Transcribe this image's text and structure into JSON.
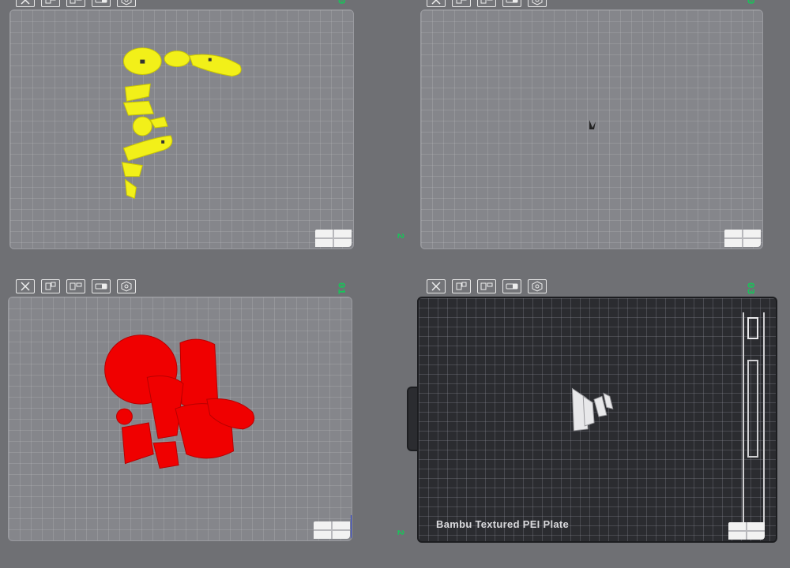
{
  "plates": [
    {
      "id": "plate-1",
      "number": "0",
      "side_number": "",
      "theme": "grey",
      "objects_color": "#f2f019"
    },
    {
      "id": "plate-2",
      "number": "0",
      "side_number": "2",
      "theme": "grey",
      "objects_color": "#222222"
    },
    {
      "id": "plate-3",
      "number": "01",
      "side_number": "",
      "theme": "grey",
      "objects_color": "#f00000"
    },
    {
      "id": "plate-4",
      "number": "03",
      "side_number": "2",
      "theme": "dark",
      "objects_color": "#e8e8ea",
      "plate_type_label": "Bambu Textured PEI Plate"
    }
  ],
  "toolbar_icons": [
    "delete-icon",
    "arrange-icon",
    "layout-icon",
    "slice-icon",
    "settings-icon"
  ],
  "colors": {
    "accent_green": "#18c45a"
  }
}
